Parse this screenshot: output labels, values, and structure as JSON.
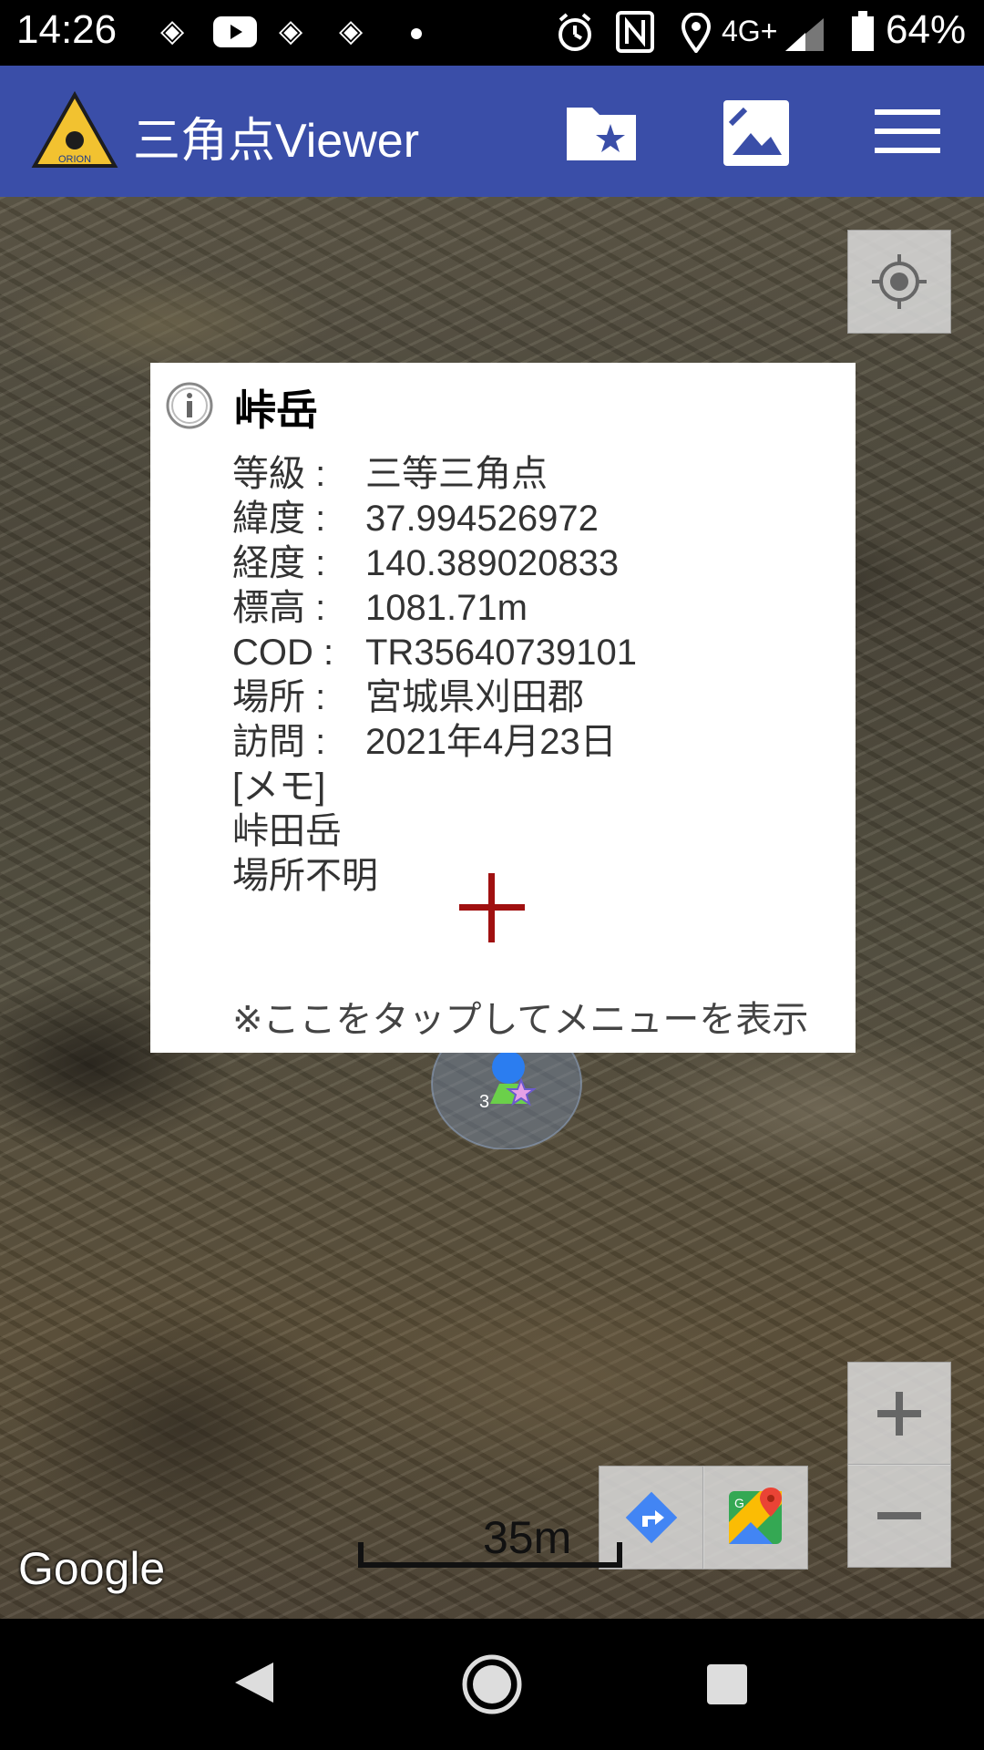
{
  "status_bar": {
    "time": "14:26",
    "network": "4G+",
    "battery": "64%"
  },
  "app_bar": {
    "title": "三角点Viewer",
    "logo_text": "ORION",
    "icons": [
      "folder-star-icon",
      "image-icon",
      "menu-icon"
    ]
  },
  "info_window": {
    "title": "峠岳",
    "rows": [
      {
        "key": "等級 :",
        "value": "三等三角点"
      },
      {
        "key": "緯度 :",
        "value": "37.994526972"
      },
      {
        "key": "経度 :",
        "value": "140.389020833"
      },
      {
        "key": "標高 :",
        "value": "1081.71m"
      },
      {
        "key": "COD :",
        "value": "TR35640739101"
      },
      {
        "key": "場所 :",
        "value": "宮城県刈田郡"
      },
      {
        "key": "訪問 :",
        "value": "2021年4月23日"
      }
    ],
    "memo_label": "[メモ]",
    "memo_lines": [
      "峠田岳",
      "場所不明"
    ],
    "hint": "※ここをタップしてメニューを表示"
  },
  "map": {
    "scale_label": "35m",
    "attribution": "Google",
    "marker_number": "3",
    "crosshair_color": "#a01010"
  },
  "colors": {
    "app_bar": "#3a4ea8"
  }
}
